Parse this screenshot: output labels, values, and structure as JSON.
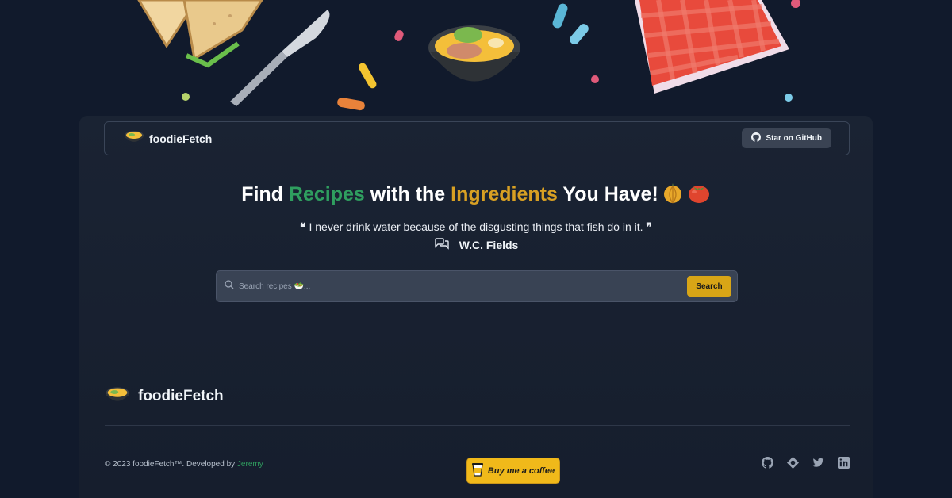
{
  "nav": {
    "brand": "foodieFetch",
    "github_button": "Star on GitHub"
  },
  "hero": {
    "title_part1": "Find ",
    "title_part2": "Recipes",
    "title_part3": " with the ",
    "title_part4": "Ingredients",
    "title_part5": " You Have!",
    "emojis": [
      "onion",
      "tomato"
    ]
  },
  "quote": {
    "text": "I never drink water because of the disgusting things that fish do in it.",
    "author": "W.C. Fields"
  },
  "search": {
    "placeholder": "Search recipes 🥗...",
    "button": "Search"
  },
  "footer": {
    "brand": "foodieFetch",
    "copyright": "© 2023 foodieFetch™. Developed by ",
    "developer": "Jeremy",
    "coffee_button": "Buy me a coffee",
    "social_icons": [
      "github-icon",
      "website-icon",
      "twitter-icon",
      "linkedin-icon"
    ]
  },
  "colors": {
    "background": "#111a2c",
    "accent_green": "#2f9e5f",
    "accent_gold": "#d8a023",
    "search_button": "#d8a516",
    "coffee_button": "#f0b91a"
  }
}
